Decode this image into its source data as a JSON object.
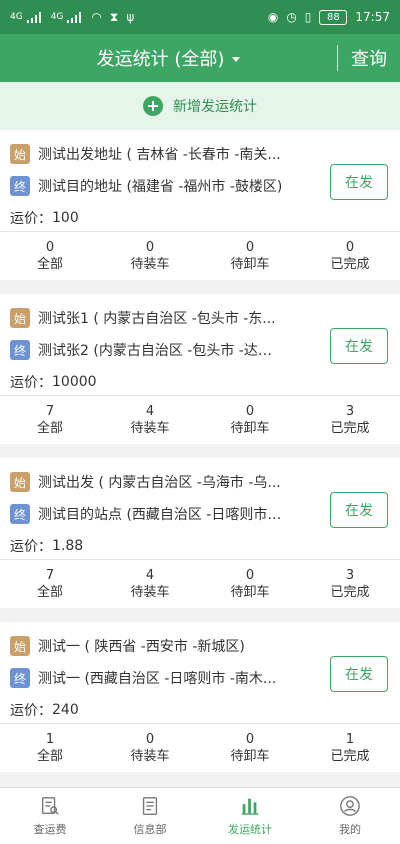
{
  "status": {
    "time": "17:57",
    "battery": "88"
  },
  "header": {
    "title": "发运统计 (全部)",
    "query": "查询"
  },
  "add": {
    "label": "新增发运统计"
  },
  "tags": {
    "start": "始",
    "end": "终"
  },
  "price_prefix": "运价：",
  "btn_label": "在发",
  "stat_labels": [
    "全部",
    "待装车",
    "待卸车",
    "已完成"
  ],
  "cards": [
    {
      "start": "测试出发地址 ( 吉林省 -长春市 -南关...",
      "end": "测试目的地址 (福建省 -福州市 -鼓楼区)",
      "price": "100",
      "counts": [
        "0",
        "0",
        "0",
        "0"
      ]
    },
    {
      "start": "测试张1 ( 内蒙古自治区 -包头市 -东...",
      "end": "测试张2 (内蒙古自治区 -包头市 -达尔...",
      "price": "10000",
      "counts": [
        "7",
        "4",
        "0",
        "3"
      ]
    },
    {
      "start": "测试出发 ( 内蒙古自治区 -乌海市 -乌...",
      "end": "测试目的站点 (西藏自治区 -日喀则市 ...",
      "price": "1.88",
      "counts": [
        "7",
        "4",
        "0",
        "3"
      ]
    },
    {
      "start": "测试一 ( 陕西省 -西安市 -新城区)",
      "end": "测试一 (西藏自治区 -日喀则市 -南木...",
      "price": "240",
      "counts": [
        "1",
        "0",
        "0",
        "1"
      ]
    }
  ],
  "tabs": [
    {
      "label": "查运费"
    },
    {
      "label": "信息部"
    },
    {
      "label": "发运统计"
    },
    {
      "label": "我的"
    }
  ],
  "colors": {
    "primary": "#3ea664",
    "status_bar": "#2f8f52",
    "start_tag": "#c9a06a",
    "end_tag": "#6d93d3"
  }
}
